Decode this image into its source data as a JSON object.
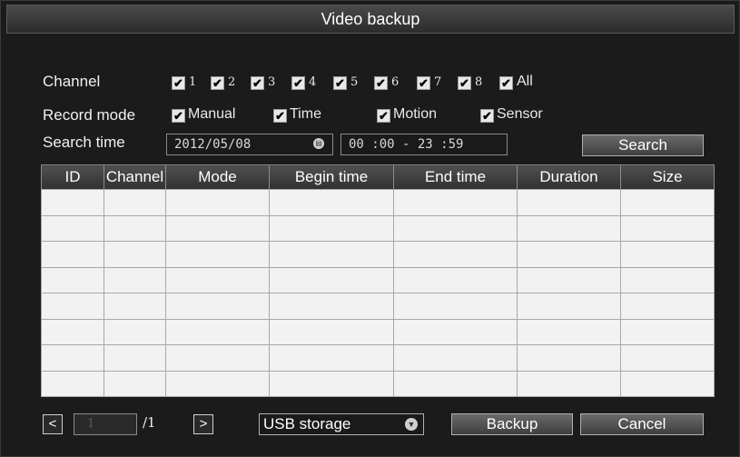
{
  "title": "Video backup",
  "labels": {
    "channel": "Channel",
    "record_mode": "Record mode",
    "search_time": "Search time"
  },
  "channels": [
    "1",
    "2",
    "3",
    "4",
    "5",
    "6",
    "7",
    "8",
    "All"
  ],
  "modes": [
    "Manual",
    "Time",
    "Motion",
    "Sensor"
  ],
  "search": {
    "date": "2012/05/08",
    "time_range": "00 :00 - 23 :59",
    "button": "Search"
  },
  "table": {
    "columns": [
      "ID",
      "Channel",
      "Mode",
      "Begin time",
      "End time",
      "Duration",
      "Size"
    ],
    "rows": 8
  },
  "pager": {
    "prev": "<",
    "current": "1",
    "total": "/1",
    "next": ">"
  },
  "storage": {
    "selected": "USB storage"
  },
  "buttons": {
    "backup": "Backup",
    "cancel": "Cancel"
  },
  "check_mark": "✔"
}
